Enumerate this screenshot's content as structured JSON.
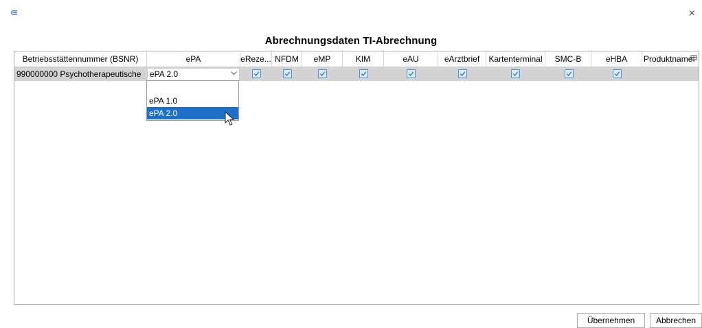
{
  "dialog": {
    "title": "Abrechnungsdaten TI-Abrechnung",
    "close_glyph": "×",
    "app_icon": "app-icon"
  },
  "table": {
    "columns": [
      "Betriebsstättennummer (BSNR)",
      "ePA",
      "eReze...",
      "NFDM",
      "eMP",
      "KIM",
      "eAU",
      "eArztbrief",
      "Kartenterminal",
      "SMC-B",
      "eHBA",
      "Produktname"
    ],
    "rows": [
      {
        "bsnr": "990000000 Psychotherapeutische",
        "epa": "ePA 2.0",
        "checks": [
          true,
          true,
          true,
          true,
          true,
          true,
          true,
          true,
          true
        ],
        "produktname": ""
      }
    ]
  },
  "dropdown": {
    "options": [
      "",
      "ePA 1.0",
      "ePA 2.0"
    ],
    "selected": "ePA 2.0"
  },
  "buttons": {
    "accept": "Übernehmen",
    "cancel": "Abbrechen"
  },
  "colors": {
    "selection": "#1e6fc6",
    "row_selected": "#d3d3d3",
    "checkbox": "#4a90d9"
  }
}
